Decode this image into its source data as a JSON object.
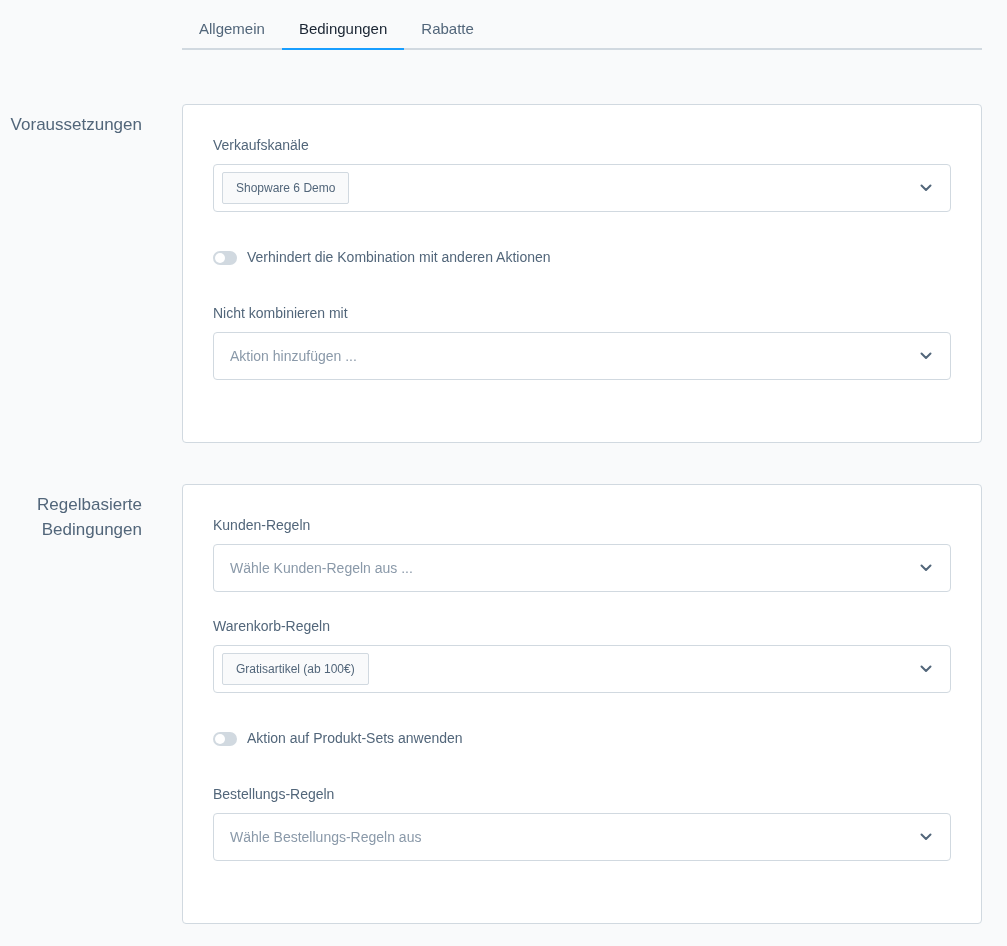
{
  "tabs": [
    {
      "label": "Allgemein",
      "selected": false
    },
    {
      "label": "Bedingungen",
      "selected": true
    },
    {
      "label": "Rabatte",
      "selected": false
    }
  ],
  "sections": [
    {
      "title": "Voraussetzungen",
      "fields": [
        {
          "kind": "select",
          "label": "Verkaufskanäle",
          "tags": [
            "Shopware 6 Demo"
          ]
        },
        {
          "kind": "toggle",
          "label": "Verhindert die Kombination mit anderen Aktionen",
          "on": false
        },
        {
          "kind": "select",
          "label": "Nicht kombinieren mit",
          "placeholder": "Aktion hinzufügen ..."
        }
      ]
    },
    {
      "title": "Regelbasierte Bedingungen",
      "fields": [
        {
          "kind": "select",
          "label": "Kunden-Regeln",
          "placeholder": "Wähle Kunden-Regeln aus ..."
        },
        {
          "kind": "select",
          "label": "Warenkorb-Regeln",
          "tags": [
            "Gratisartikel (ab 100€)"
          ]
        },
        {
          "kind": "toggle",
          "label": "Aktion auf Produkt-Sets anwenden",
          "on": false
        },
        {
          "kind": "select",
          "label": "Bestellungs-Regeln",
          "placeholder": "Wähle Bestellungs-Regeln aus"
        }
      ]
    }
  ]
}
